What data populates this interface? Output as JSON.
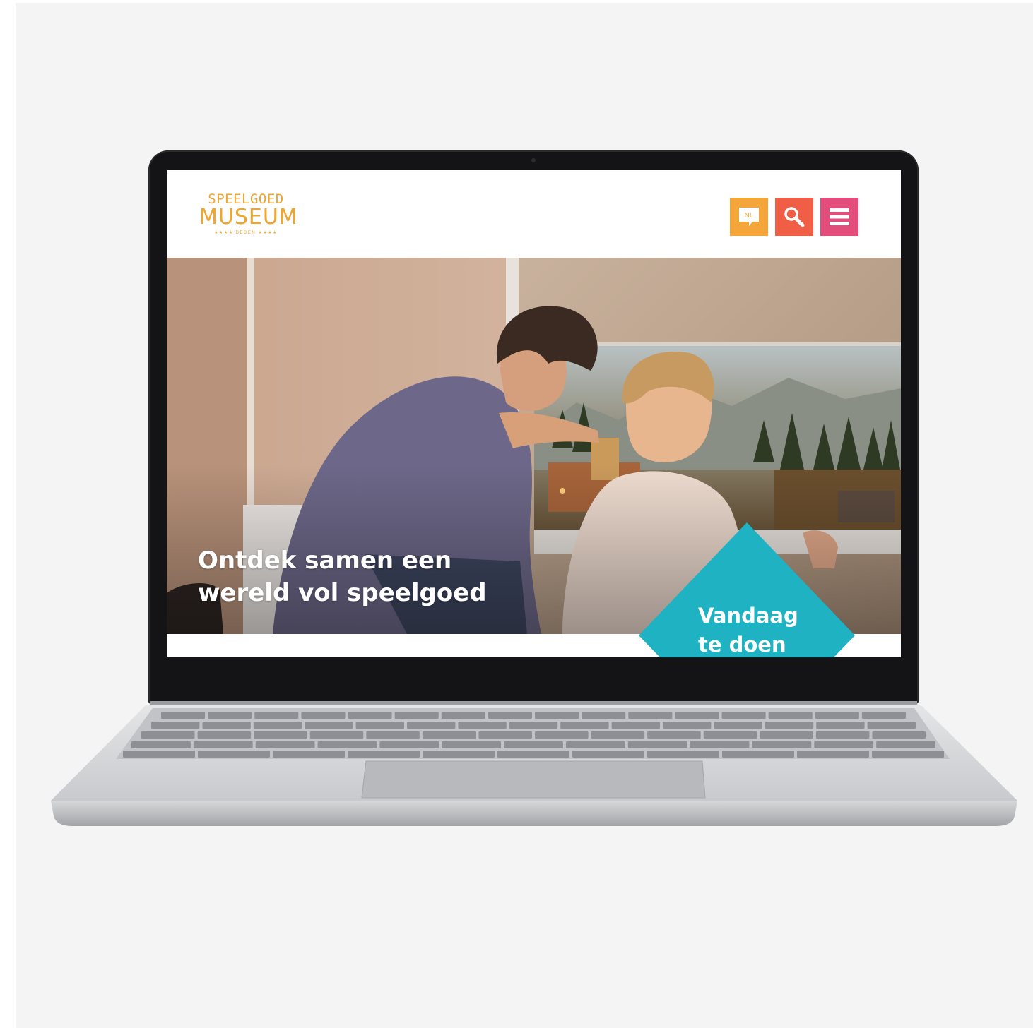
{
  "site": {
    "logo": {
      "line1": "SPEELGOED",
      "line2": "MUSEUM",
      "line3": "★★★★ DEDEN ★★★★"
    },
    "header_buttons": {
      "language_label": "NL",
      "search_icon": "search-icon",
      "menu_icon": "hamburger-menu-icon"
    },
    "colors": {
      "logo": "#f0a52c",
      "language_button": "#f4a63a",
      "search_button": "#ef5e45",
      "menu_button": "#e24d7b",
      "cta": "#1fb2c2"
    },
    "hero": {
      "tagline_line1": "Ontdek samen een",
      "tagline_line2": "wereld vol speelgoed"
    },
    "cta": {
      "line1": "Vandaag",
      "line2": "te doen"
    }
  }
}
